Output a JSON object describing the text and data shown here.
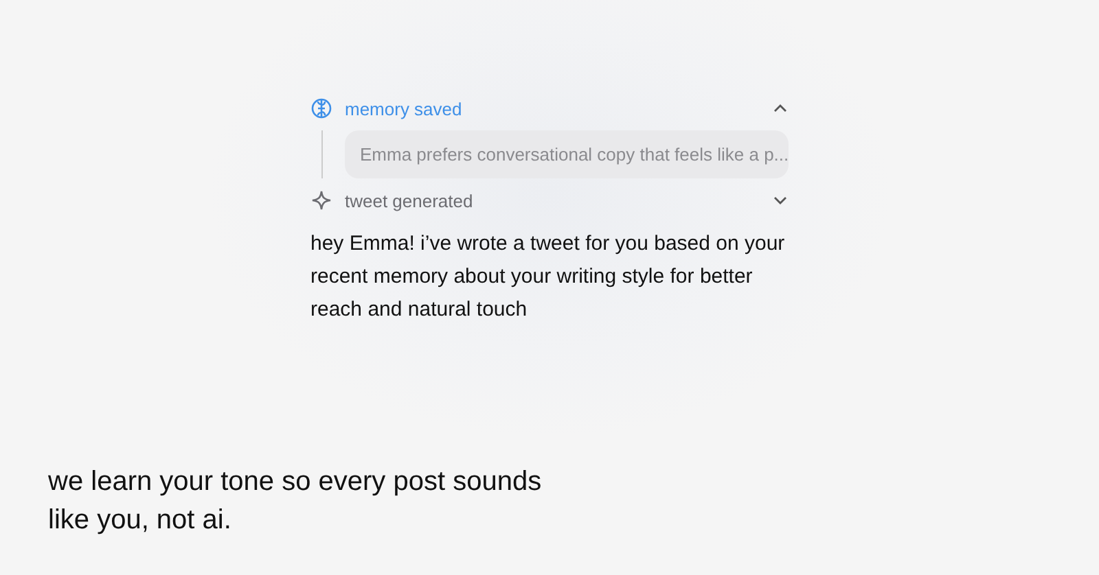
{
  "steps": [
    {
      "kind": "memory",
      "label": "memory saved",
      "expanded": true,
      "detail": "Emma prefers conversational copy that feels like a p..."
    },
    {
      "kind": "sparkle",
      "label": "tweet generated",
      "expanded": false
    }
  ],
  "message": "hey Emma! i’ve wrote a tweet for you based on your recent memory about your writing style for better reach and natural touch",
  "caption": "we learn your tone so every post sounds like you, not ai."
}
